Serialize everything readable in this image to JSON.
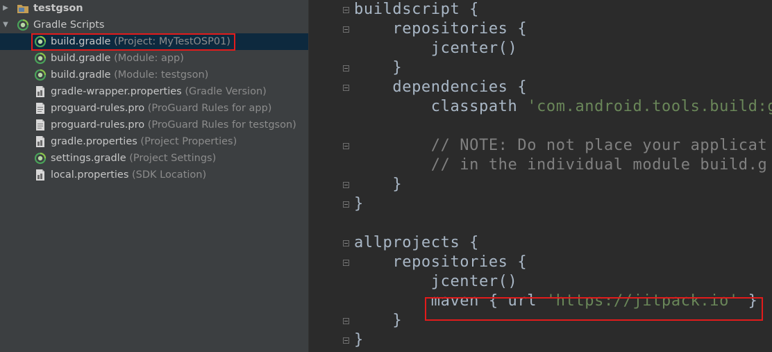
{
  "project_tree": {
    "items": [
      {
        "name": "testgson",
        "detail": "",
        "icon": "folder-module-icon",
        "bold": true
      },
      {
        "name": "Gradle Scripts",
        "detail": "",
        "icon": "gradle-icon",
        "bold": false
      },
      {
        "name": "build.gradle",
        "detail": "(Project: MyTestOSP01)",
        "icon": "gradle-file-icon",
        "selected": true,
        "highlighted": true
      },
      {
        "name": "build.gradle",
        "detail": "(Module: app)",
        "icon": "gradle-file-icon"
      },
      {
        "name": "build.gradle",
        "detail": "(Module: testgson)",
        "icon": "gradle-file-icon"
      },
      {
        "name": "gradle-wrapper.properties",
        "detail": "(Gradle Version)",
        "icon": "properties-file-icon"
      },
      {
        "name": "proguard-rules.pro",
        "detail": "(ProGuard Rules for app)",
        "icon": "text-file-icon"
      },
      {
        "name": "proguard-rules.pro",
        "detail": "(ProGuard Rules for testgson)",
        "icon": "text-file-icon"
      },
      {
        "name": "gradle.properties",
        "detail": "(Project Properties)",
        "icon": "properties-file-icon"
      },
      {
        "name": "settings.gradle",
        "detail": "(Project Settings)",
        "icon": "gradle-file-icon"
      },
      {
        "name": "local.properties",
        "detail": "(SDK Location)",
        "icon": "properties-file-icon"
      }
    ]
  },
  "editor": {
    "lines": [
      [
        {
          "t": "buildscript {",
          "c": "plain"
        }
      ],
      [
        {
          "t": "    repositories {",
          "c": "plain"
        }
      ],
      [
        {
          "t": "        jcenter()",
          "c": "plain"
        }
      ],
      [
        {
          "t": "    }",
          "c": "plain"
        }
      ],
      [
        {
          "t": "    dependencies {",
          "c": "plain"
        }
      ],
      [
        {
          "t": "        classpath ",
          "c": "plain"
        },
        {
          "t": "'com.android.tools.build:g",
          "c": "string"
        }
      ],
      [
        {
          "t": "",
          "c": "plain"
        }
      ],
      [
        {
          "t": "        // NOTE: Do not place your applicat",
          "c": "comment"
        }
      ],
      [
        {
          "t": "        // in the individual module build.g",
          "c": "comment"
        }
      ],
      [
        {
          "t": "    }",
          "c": "plain"
        }
      ],
      [
        {
          "t": "}",
          "c": "plain"
        }
      ],
      [
        {
          "t": "",
          "c": "plain"
        }
      ],
      [
        {
          "t": "allprojects {",
          "c": "plain"
        }
      ],
      [
        {
          "t": "    repositories {",
          "c": "plain"
        }
      ],
      [
        {
          "t": "        jcenter()",
          "c": "plain"
        }
      ],
      [
        {
          "t": "        maven { url ",
          "c": "plain"
        },
        {
          "t": "'https://jitpack.io'",
          "c": "string"
        },
        {
          "t": " }",
          "c": "plain"
        }
      ],
      [
        {
          "t": "    }",
          "c": "plain"
        }
      ],
      [
        {
          "t": "}",
          "c": "plain"
        }
      ]
    ],
    "highlighted_line_index": 15
  },
  "colors": {
    "tree_bg": "#3c3f41",
    "selection": "#0d293e",
    "editor_bg": "#2b2b2b",
    "code_text": "#a9b7c6",
    "string": "#6a8759",
    "comment": "#808080",
    "highlight_box": "#e31b1b"
  }
}
